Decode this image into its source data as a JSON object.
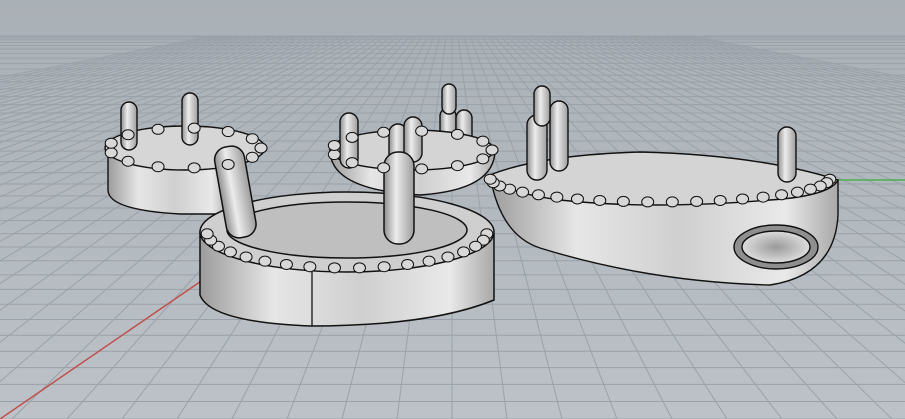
{
  "viewport": {
    "colors": {
      "sky_top": "#a9b0b6",
      "sky_bottom": "#b8bec4",
      "floor": "#b3b9bf",
      "grid_line": "#9aa1a8",
      "x_axis": "#c0504d",
      "y_axis": "#4caf50",
      "model_fill": "#d9d9d9",
      "model_shadow": "#9a9a9a",
      "outline": "#111111"
    },
    "objects": [
      {
        "name": "ring-base-back-left"
      },
      {
        "name": "ring-base-front"
      },
      {
        "name": "oval-base-with-hole"
      }
    ]
  }
}
